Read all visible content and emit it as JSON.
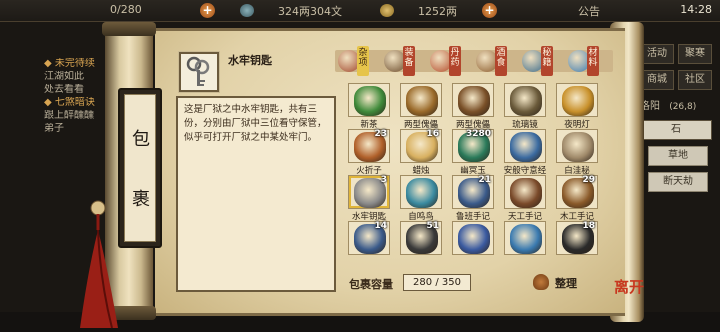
{
  "topbar": {
    "level_text": "0/280",
    "currency_1": "324两304文",
    "currency_2": "1252两",
    "announcement": "公告",
    "time": "14:28"
  },
  "quests": [
    {
      "title": "◆ 未完待续",
      "lines": [
        "江湖如此",
        "处去看看"
      ]
    },
    {
      "title": "◆ 七煞暗诀",
      "lines": [
        "跟上醉醺醺",
        "弟子"
      ]
    }
  ],
  "right_menu": {
    "btn_1": "活动",
    "btn_2": "聚寒",
    "btn_3": "商城",
    "btn_4": "社区",
    "location": "洛阳",
    "coords": "(26,8)",
    "row_5": "石",
    "btn_grass": "草地",
    "btn_sky": "断天劫"
  },
  "panel": {
    "title_chars": [
      "包",
      "裹"
    ],
    "selected_name": "水牢钥匙",
    "selected_icon": "keys-icon",
    "description": "这是厂狱之中水牢钥匙，共有三份，分别由厂狱中三位看守保管，似乎可打开厂狱之中某处牢门。",
    "capacity_label": "包裹容量",
    "capacity_value": "280 / 350",
    "sort_label": "整理"
  },
  "tabs": [
    {
      "label": "杂项",
      "icon": "pot-icon",
      "color": "#a0452a",
      "active": true
    },
    {
      "label": "装备",
      "icon": "sword-icon",
      "color": "#6a4a2a",
      "active": false
    },
    {
      "label": "丹药",
      "icon": "pill-icon",
      "color": "#b34a2a",
      "active": false
    },
    {
      "label": "酒食",
      "icon": "jug-icon",
      "color": "#8a5a2a",
      "active": false
    },
    {
      "label": "秘籍",
      "icon": "book-icon",
      "color": "#3a6a8a",
      "active": false
    },
    {
      "label": "材料",
      "icon": "crystal-icon",
      "color": "#3b7ab0",
      "active": false
    }
  ],
  "items": [
    {
      "name": "新茶",
      "count": "",
      "icon": "tea-icon",
      "color": "#3f8a3a"
    },
    {
      "name": "两型傀儡",
      "count": "",
      "icon": "puppet-icon",
      "color": "#9a6a2a"
    },
    {
      "name": "两型傀儡",
      "count": "",
      "icon": "puppet-icon",
      "color": "#7a5028"
    },
    {
      "name": "琉璃镜",
      "count": "",
      "icon": "telescope-icon",
      "color": "#6a5a3a"
    },
    {
      "name": "夜明灯",
      "count": "",
      "icon": "lantern-icon",
      "color": "#c8902a"
    },
    {
      "name": "火折子",
      "count": "23",
      "icon": "torch-icon",
      "color": "#b0602a"
    },
    {
      "name": "蜡烛",
      "count": "16",
      "icon": "candle-icon",
      "color": "#d8b060"
    },
    {
      "name": "幽冥玉",
      "count": "3280",
      "icon": "jade-icon",
      "color": "#2a7a5a"
    },
    {
      "name": "安般守意经",
      "count": "",
      "icon": "scroll-icon",
      "color": "#3a6aa0"
    },
    {
      "name": "白洼秘",
      "count": "",
      "icon": "scroll-icon",
      "color": "#a08a6a"
    },
    {
      "name": "水牢钥匙",
      "count": "3",
      "icon": "keys-icon",
      "color": "#8a8a8a"
    },
    {
      "name": "自鸣鸟",
      "count": "",
      "icon": "bird-icon",
      "color": "#3a8aa0"
    },
    {
      "name": "鲁班手记",
      "count": "21",
      "icon": "book-icon",
      "color": "#3a5a8a"
    },
    {
      "name": "天工手记",
      "count": "",
      "icon": "book-icon",
      "color": "#7a4a2a"
    },
    {
      "name": "木工手记",
      "count": "29",
      "icon": "book-icon",
      "color": "#8a5a2a"
    },
    {
      "name": "",
      "count": "14",
      "icon": "ore-icon",
      "color": "#3a5a8a"
    },
    {
      "name": "",
      "count": "51",
      "icon": "coal-icon",
      "color": "#3a3a3a"
    },
    {
      "name": "",
      "count": "",
      "icon": "vase-icon",
      "color": "#3a5aa0"
    },
    {
      "name": "",
      "count": "",
      "icon": "scroll-icon",
      "color": "#3a7ab0"
    },
    {
      "name": "",
      "count": "18",
      "icon": "inkstone-icon",
      "color": "#2a2a2a"
    }
  ],
  "corner_mark": "离开"
}
